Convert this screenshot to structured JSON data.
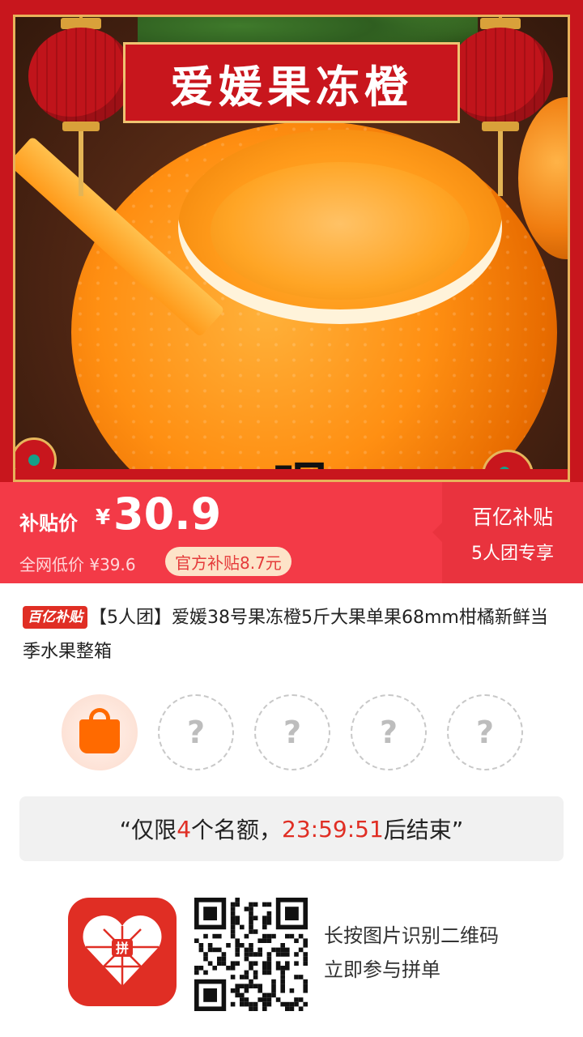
{
  "hero": {
    "banner_title": "爱媛果冻橙",
    "bottom_overlay_text": "喝"
  },
  "price_bar": {
    "subsidy_label": "补贴价",
    "currency": "¥",
    "price": "30.9",
    "market_low_price": "全网低价 ¥39.6",
    "official_subsidy": "官方补贴8.7元",
    "badge_title": "百亿补贴",
    "badge_subtitle": "5人团专享",
    "colors": {
      "bar": "#f33a47",
      "badge_bg": "#e9333e"
    }
  },
  "product": {
    "tag_label": "百亿补贴",
    "title": "【5人团】爱媛38号果冻橙5斤大果单果68mm柑橘新鲜当季水果整箱"
  },
  "group": {
    "slots": [
      {
        "state": "filled",
        "icon": "shopping-bag-icon"
      },
      {
        "state": "empty",
        "label": "?"
      },
      {
        "state": "empty",
        "label": "?"
      },
      {
        "state": "empty",
        "label": "?"
      },
      {
        "state": "empty",
        "label": "?"
      }
    ]
  },
  "countdown": {
    "prefix": "“仅限",
    "count": "4",
    "middle": "个名额，",
    "time": "23:59:51",
    "suffix": "后结束”"
  },
  "footer": {
    "app_icon": "pinduoduo-logo-icon",
    "logo_center_text": "拼",
    "qr_icon": "qr-code-icon",
    "line1": "长按图片识别二维码",
    "line2": "立即参与拼单"
  }
}
